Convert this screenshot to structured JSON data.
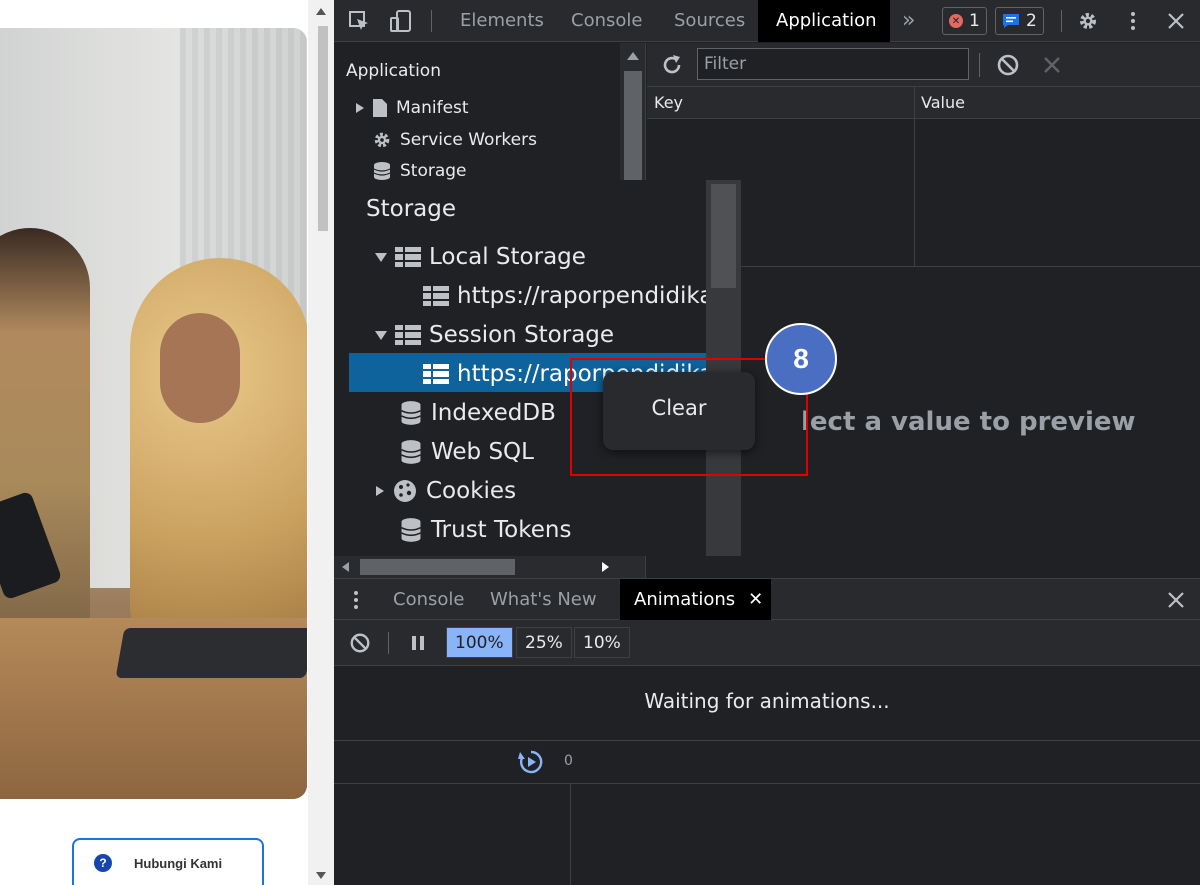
{
  "webpage": {
    "contact_button_label": "Hubungi Kami",
    "help_icon_glyph": "?"
  },
  "devtools": {
    "main_tabs": [
      "Elements",
      "Console",
      "Sources",
      "Application"
    ],
    "active_tab": "Application",
    "more_tabs_glyph": "»",
    "errors_count": "1",
    "messages_count": "2",
    "sidebar": {
      "section_title": "Application",
      "items": [
        "Manifest",
        "Service Workers",
        "Storage"
      ]
    },
    "zoomed_sidebar": {
      "section_title": "Storage",
      "local_storage": "Local Storage",
      "local_storage_origin": "https://raporpendidikan.",
      "session_storage": "Session Storage",
      "session_storage_origin": "https://raporpendidikan",
      "indexeddb": "IndexedDB",
      "websql": "Web SQL",
      "cookies": "Cookies",
      "trust_tokens": "Trust Tokens"
    },
    "storage_table": {
      "filter_placeholder": "Filter",
      "columns": [
        "Key",
        "Value"
      ],
      "preview_text": "lect a value to preview"
    },
    "context_menu": {
      "items": [
        "Clear"
      ]
    },
    "step_badge": "8",
    "drawer": {
      "tabs": [
        "Console",
        "What's New",
        "Animations"
      ],
      "active_tab": "Animations",
      "speeds": [
        "100%",
        "25%",
        "10%"
      ],
      "active_speed": "100%",
      "waiting_text": "Waiting for animations...",
      "timeline_zero": "0"
    }
  },
  "colors": {
    "accent": "#8ab4f8",
    "selection": "#0e639c",
    "highlight": "#e00000",
    "step_badge": "#4a6fc2"
  }
}
